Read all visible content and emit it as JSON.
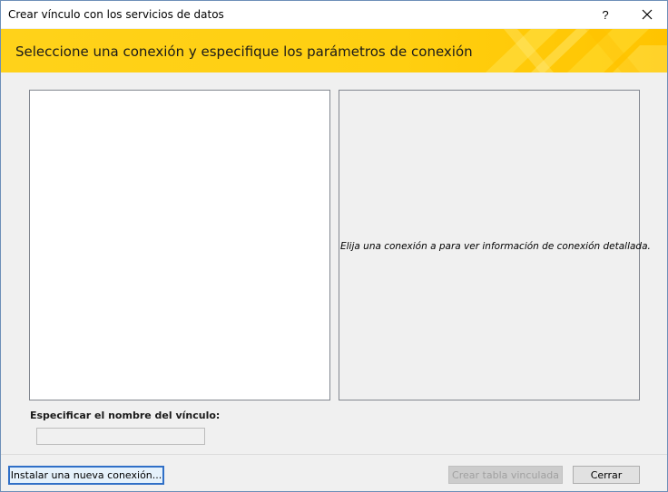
{
  "window": {
    "title": "Crear vínculo con los servicios de datos",
    "help_glyph": "?",
    "close_glyph": "✕"
  },
  "banner": {
    "title": "Seleccione una conexión y especifique los parámetros de conexión"
  },
  "info_panel": {
    "text": "Elija una conexión a para ver información de conexión detallada."
  },
  "link_name": {
    "label": "Especificar el nombre del vínculo:",
    "value": ""
  },
  "buttons": {
    "install": "Instalar una nueva conexión...",
    "create": "Crear tabla vinculada",
    "close": "Cerrar"
  },
  "colors": {
    "banner": "#ffd21a",
    "focus_border": "#2f6fc7"
  }
}
